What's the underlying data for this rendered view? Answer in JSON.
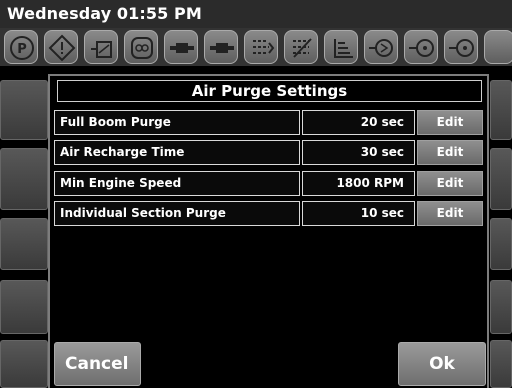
{
  "status_bar": {
    "datetime": "Wednesday 01:55 PM"
  },
  "toolbar_icons": [
    "park-icon",
    "warning-icon",
    "tank-icon",
    "boom-icon",
    "nozzle-icon",
    "nozzle-icon",
    "section-icon",
    "section-off-icon",
    "level-icon",
    "pump-icon",
    "valve-icon"
  ],
  "dialog": {
    "title": "Air Purge Settings",
    "rows": [
      {
        "label": "Full Boom Purge",
        "value": "20 sec",
        "edit_label": "Edit"
      },
      {
        "label": "Air Recharge Time",
        "value": "30 sec",
        "edit_label": "Edit"
      },
      {
        "label": "Min Engine Speed",
        "value": "1800 RPM",
        "edit_label": "Edit"
      },
      {
        "label": "Individual Section Purge",
        "value": "10 sec",
        "edit_label": "Edit"
      }
    ],
    "cancel_label": "Cancel",
    "ok_label": "Ok"
  },
  "colors": {
    "background": "#000000",
    "button": "#7f7f7f",
    "border": "#d9d9d9",
    "text": "#ffffff"
  }
}
